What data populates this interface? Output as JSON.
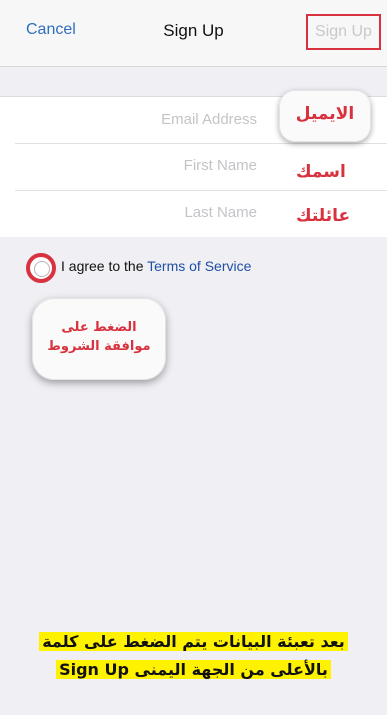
{
  "navbar": {
    "cancel_label": "Cancel",
    "title": "Sign Up",
    "signup_label": "Sign Up"
  },
  "form": {
    "email_placeholder": "Email Address",
    "first_name_placeholder": "First Name",
    "last_name_placeholder": "Last Name"
  },
  "annotations": {
    "email_label": "الايميل",
    "first_name_label": "اسمك",
    "last_name_label": "عائلتك",
    "agree_hint": "الضغط على موافقة الشروط",
    "caption_line1": "بعد تعبئة البيانات يتم الضغط على كلمة",
    "caption_line2": "Sign Up بالأعلى من الجهة اليمنى"
  },
  "terms": {
    "prefix": "I agree to the ",
    "link_label": "Terms of Service"
  },
  "colors": {
    "accent_red": "#d8323f",
    "link_blue": "#2f6fbf",
    "highlight_yellow": "#fff200"
  }
}
